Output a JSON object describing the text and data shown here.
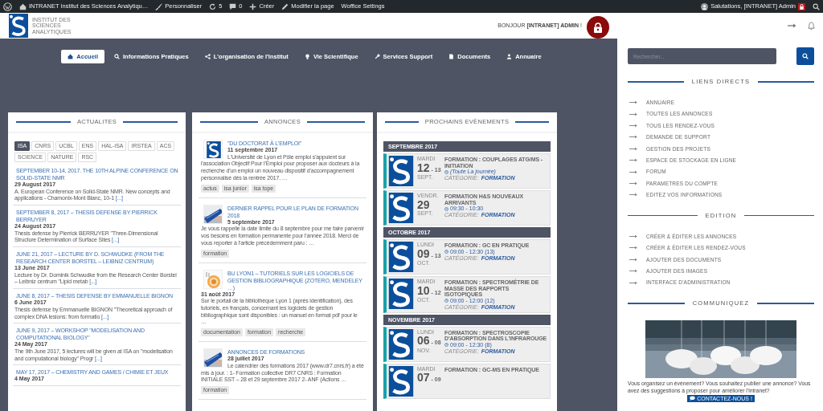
{
  "admin_bar": {
    "site": "INTRANET Institut des Sciences Analytiqu…",
    "customize": "Personnaliser",
    "updates": "5",
    "comments": "0",
    "new": "Créer",
    "edit": "Modifier la page",
    "settings": "Woffice Settings",
    "greeting": "Salutations, [INTRANET] Admin"
  },
  "header": {
    "logo_text": "INSTITUT DES SCIENCES ANALYTIQUES",
    "greeting": "BONJOUR **[INTRANET] ADMIN** !"
  },
  "nav": [
    {
      "label": "Accueil",
      "selected": true
    },
    {
      "label": "Informations Pratiques",
      "selected": false
    },
    {
      "label": "L'organisation de l'Institut",
      "selected": false
    },
    {
      "label": "Vie Scientifique",
      "selected": false
    },
    {
      "label": "Services Support",
      "selected": false
    },
    {
      "label": "Documents",
      "selected": false
    },
    {
      "label": "Annuaire",
      "selected": false
    }
  ],
  "news": {
    "title": "ACTUALITES",
    "filters": [
      {
        "label": "ISA",
        "selected": true
      },
      {
        "label": "CNRS",
        "selected": false
      },
      {
        "label": "UCBL",
        "selected": false
      },
      {
        "label": "ENS",
        "selected": false
      },
      {
        "label": "HAL-ISA",
        "selected": false
      },
      {
        "label": "IRSTEA",
        "selected": false
      },
      {
        "label": "ACS",
        "selected": false
      },
      {
        "label": "SCIENCE",
        "selected": false
      },
      {
        "label": "NATURE",
        "selected": false
      },
      {
        "label": "RSC",
        "selected": false
      }
    ],
    "items": [
      {
        "title": "SEPTEMBER 10-14, 2017. THE 10TH ALPINE CONFERENCE ON SOLID-STATE NMR",
        "date": "29 August 2017",
        "excerpt": "A. European Conference on Solid-State NMR. New concepts and applications - Chamonix-Mont Blanc, 10-1",
        "more": "[...]"
      },
      {
        "title": "SEPTEMBER 8, 2017 – THESIS DEFENSE BY PIERRICK BERRUYER",
        "date": "24 August 2017",
        "excerpt": "Thesis defense by Pierrick BERRUYER \"Three-Dimensional Structure Determination of Surface Sites",
        "more": "[...]"
      },
      {
        "title": "JUNE 21, 2017 – LECTURE BY D. SCHWUDKE (FROM THE RESEARCH CENTER BORSTEL – LEIBNIZ CENTRUM)",
        "date": "13 June 2017",
        "excerpt": "Lecture by Dr. Dominik Schwudke from the Research Center Borstel – Leibniz centrum \"Lipid metab",
        "more": "[...]"
      },
      {
        "title": "JUNE 8, 2017 – THESIS DEFENSE BY EMMANUELLE BIGNON",
        "date": "6 June 2017",
        "excerpt": "Thesis defense by Emmanuelle BIGNON \"Theoretical approach of complex DNA lesions: from formatio",
        "more": "[...]"
      },
      {
        "title": "JUNE 9, 2017 – WORKSHOP \"MODELISATION AND COMPUTATIONAL BIOLOGY\"",
        "date": "24 May 2017",
        "excerpt": "The 9th June 2017, 5 lectures will be given at ISA on \"modelisation and computational biology\" Progr",
        "more": "[...]"
      },
      {
        "title": "MAY 17, 2017 – CHEMISTRY AND GAMES / CHIMIE ET JEUX",
        "date": "4 May 2017"
      }
    ]
  },
  "announcements": {
    "title": "ANNONCES",
    "items": [
      {
        "kind": "logo",
        "title": "\"DU DOCTORAT À L'EMPLOI\"",
        "date": "11 septembre 2017",
        "excerpt": "L'Université de Lyon et Pôle emploi s'appuient sur l'association Objectif Pour l'Emploi pour proposer aux docteurs à la recherche d'un emploi un nouveau dispositif d'accompagnement personnalisé dès la rentrée 2017. …",
        "tags": [
          "actus",
          "isa junior",
          "isa tope"
        ]
      },
      {
        "kind": "picture",
        "title": "DERNIER RAPPEL POUR LE PLAN DE FORMATION 2018",
        "date": "5 septembre 2017",
        "excerpt": "Je vous rappelle la date limite du 8 septembre pour me faire parvenir vos besoins en formation permanente pour l'année 2018. Merci de vous reporter à l'article précédemment paru : …",
        "tags": [
          "formation"
        ]
      },
      {
        "kind": "picture",
        "title": "BU LYON1 – TUTORIELS SUR LES LOGICIELS DE GESTION BIBLIOGRAPHIQUE (ZOTERO, MENDELEY …)",
        "date": "31 août 2017",
        "excerpt": "Sur le portail de la bibliothèque Lyon 1 (après identification), des tutoriels, en français, concernant les logiciels de gestion bibliographique sont disponibles : un manuel en format pdf pour le …",
        "tags": [
          "documentation",
          "formation",
          "recherche"
        ]
      },
      {
        "kind": "picture",
        "title": "ANNONCES DE FORMATIONS",
        "date": "28 juillet 2017",
        "excerpt": "Le calendrier des formations 2017 (www.dr7.cnrs.fr) a été mis à jour. : 1- Formation collective DR7 CNRS : Formation INITIALE SST – 28 et 29 septembre 2017 2- ANF (Actions …",
        "tags": [
          "formation"
        ]
      }
    ]
  },
  "events": {
    "title": "PROCHAINS EVÈNEMENTS",
    "months": [
      {
        "label": "SEPTEMBRE 2017",
        "events": [
          {
            "weekday": "MARDI",
            "day": "12",
            "end_day": "- 13",
            "month": "SEPT.",
            "title": "FORMATION : COUPLAGES ATG/MS - INITIATION",
            "time": "(Toute La journée)",
            "all_day": true,
            "category_label": "CATÉGORIE:",
            "category": "FORMATION"
          },
          {
            "weekday": "VENDR.",
            "day": "29",
            "month": "SEPT.",
            "title": "FORMATION H&S NOUVEAUX ARRIVANTS",
            "time": "09:30 - 10:30",
            "all_day": false,
            "category_label": "CATÉGORIE:",
            "category": "FORMATION"
          }
        ]
      },
      {
        "label": "OCTOBRE 2017",
        "events": [
          {
            "weekday": "LUNDI",
            "day": "09",
            "end_day": "- 13",
            "month": "OCT.",
            "title": "FORMATION : GC EN PRATIQUE",
            "time": "09:00 - 12:30 (13)",
            "all_day": false,
            "category_label": "CATÉGORIE:",
            "category": "FORMATION"
          },
          {
            "weekday": "MARDI",
            "day": "10",
            "end_day": "- 12",
            "month": "OCT.",
            "title": "FORMATION : SPECTROMÉTRIE DE MASSE DES RAPPORTS ISOTOPIQUES",
            "time": "09:00 - 12:00 (12)",
            "all_day": false,
            "category_label": "CATÉGORIE:",
            "category": "FORMATION"
          }
        ]
      },
      {
        "label": "NOVEMBRE 2017",
        "events": [
          {
            "weekday": "LUNDI",
            "day": "06",
            "end_day": "- 08",
            "month": "NOV.",
            "title": "FORMATION : SPECTROSCOPIE D'ABSORPTION DANS L'INFRAROUGE",
            "time": "09:00 - 12:30 (8)",
            "all_day": false,
            "category_label": "CATÉGORIE:",
            "category": "FORMATION"
          },
          {
            "weekday": "MARDI",
            "day": "07",
            "end_day": "- 09",
            "title": "FORMATION : GC-MS EN PRATIQUE"
          }
        ]
      }
    ]
  },
  "sidebar": {
    "search": {
      "placeholder": "Rechercher..."
    },
    "sections": [
      {
        "title": "LIENS DIRECTS",
        "links": [
          "ANNUAIRE",
          "TOUTES LES ANNONCES",
          "TOUS LES RENDEZ-VOUS",
          "DEMANDE DE SUPPORT",
          "GESTION DES PROJETS",
          "ESPACE DE STOCKAGE EN LIGNE",
          "FORUM",
          "PARAMETRES DU COMPTE",
          "EDITEZ VOS INFORMATIONS"
        ]
      },
      {
        "title": "EDITION",
        "links": [
          "CRÉER & ÉDITER LES ANNONCES",
          "CRÉER & ÉDITER LES RENDEZ-VOUS",
          "AJOUTER DES DOCUMENTS",
          "AJOUTER DES IMAGES",
          "INTERFACE D'ADMINISTRATION"
        ]
      }
    ],
    "communicate": {
      "title": "COMMUNIQUEZ",
      "text": "Vous organisez un évènement? Vous souhaitez publier une annonce? Vous avez des suggestions à proposer pour améliorer l'intranet?",
      "button": "CONTACTEZ-NOUS !"
    }
  }
}
